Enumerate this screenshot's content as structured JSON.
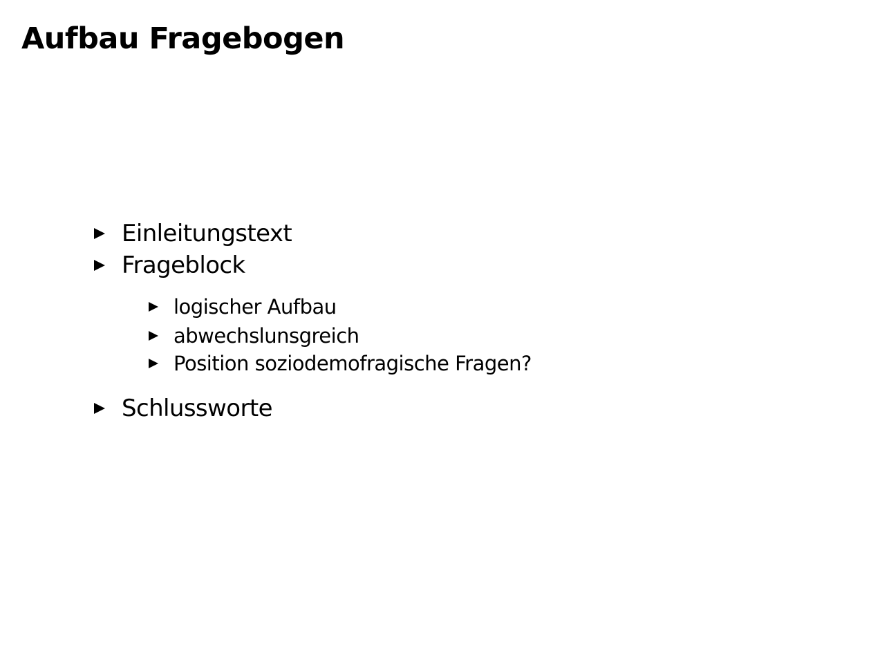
{
  "slide": {
    "title": "Aufbau Fragebogen",
    "items": [
      {
        "label": "Einleitungstext"
      },
      {
        "label": "Frageblock",
        "subitems": [
          {
            "label": "logischer Aufbau"
          },
          {
            "label": "abwechslunsgreich"
          },
          {
            "label": "Position soziodemofragische Fragen?"
          }
        ]
      },
      {
        "label": "Schlussworte"
      }
    ]
  },
  "icons": {
    "bullet": "triangle-right-icon"
  },
  "colors": {
    "background": "#ffffff",
    "text": "#000000"
  }
}
